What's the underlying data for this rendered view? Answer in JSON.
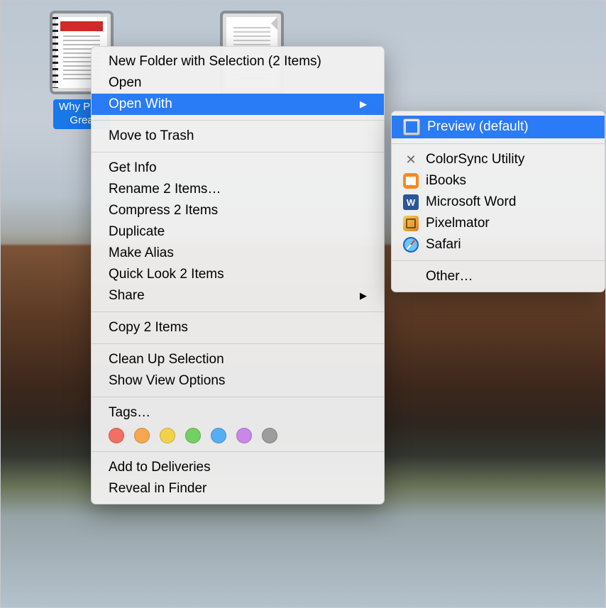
{
  "desktop": {
    "files": [
      {
        "label": "Why PDF\nGrea",
        "selected": true,
        "kind": "spiral"
      },
      {
        "label": "",
        "selected": true,
        "kind": "plain"
      }
    ]
  },
  "context_menu": {
    "groups": [
      [
        {
          "key": "new_folder_sel",
          "label": "New Folder with Selection (2 Items)",
          "submenu": false
        },
        {
          "key": "open",
          "label": "Open",
          "submenu": false
        },
        {
          "key": "open_with",
          "label": "Open With",
          "submenu": true,
          "highlight": true
        }
      ],
      [
        {
          "key": "move_to_trash",
          "label": "Move to Trash",
          "submenu": false
        }
      ],
      [
        {
          "key": "get_info",
          "label": "Get Info",
          "submenu": false
        },
        {
          "key": "rename",
          "label": "Rename 2 Items…",
          "submenu": false
        },
        {
          "key": "compress",
          "label": "Compress 2 Items",
          "submenu": false
        },
        {
          "key": "duplicate",
          "label": "Duplicate",
          "submenu": false
        },
        {
          "key": "make_alias",
          "label": "Make Alias",
          "submenu": false
        },
        {
          "key": "quick_look",
          "label": "Quick Look 2 Items",
          "submenu": false
        },
        {
          "key": "share",
          "label": "Share",
          "submenu": true
        }
      ],
      [
        {
          "key": "copy",
          "label": "Copy 2 Items",
          "submenu": false
        }
      ],
      [
        {
          "key": "clean_up",
          "label": "Clean Up Selection",
          "submenu": false
        },
        {
          "key": "view_options",
          "label": "Show View Options",
          "submenu": false
        }
      ],
      [
        {
          "key": "tags",
          "label": "Tags…",
          "submenu": false,
          "is_tags_header": true
        }
      ],
      [
        {
          "key": "add_deliveries",
          "label": "Add to Deliveries",
          "submenu": false
        },
        {
          "key": "reveal_finder",
          "label": "Reveal in Finder",
          "submenu": false
        }
      ]
    ],
    "tag_colors": [
      "#f26f63",
      "#f5a84d",
      "#f3d24a",
      "#73d062",
      "#55aef2",
      "#c987e8",
      "#9d9d9d"
    ]
  },
  "open_with_submenu": {
    "apps": [
      {
        "key": "preview",
        "label": "Preview (default)",
        "icon": "preview",
        "highlight": true
      }
    ],
    "apps_rest": [
      {
        "key": "colorsync",
        "label": "ColorSync Utility",
        "icon": "colorsync"
      },
      {
        "key": "ibooks",
        "label": "iBooks",
        "icon": "ibooks"
      },
      {
        "key": "word",
        "label": "Microsoft Word",
        "icon": "word"
      },
      {
        "key": "pixelmator",
        "label": "Pixelmator",
        "icon": "pixelmator"
      },
      {
        "key": "safari",
        "label": "Safari",
        "icon": "safari"
      }
    ],
    "other_label": "Other…"
  }
}
